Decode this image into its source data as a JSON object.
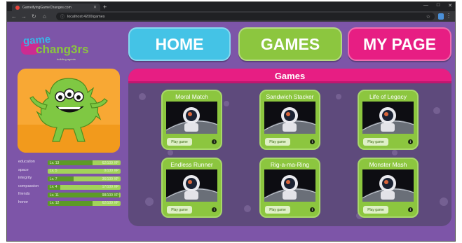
{
  "browser": {
    "tab_title": "GameifyingGameChanges.com",
    "url": "localhost:4200/games",
    "new_tab_label": "+",
    "window_controls": [
      "—",
      "□",
      "✕"
    ]
  },
  "nav": {
    "home_label": "HOME",
    "games_label": "GAMES",
    "mypage_label": "MY PAGE"
  },
  "logo": {
    "line1": "game",
    "line2": "chang3rs",
    "subtitle": "building agents"
  },
  "stats": [
    {
      "name": "education",
      "level": "Lv. 13",
      "xp": "62/100 XP",
      "progress": 0.62
    },
    {
      "name": "space",
      "level": "Lv. 5",
      "xp": "0/100 XP",
      "progress": 0.0
    },
    {
      "name": "integrity",
      "level": "Lv. 7",
      "xp": "36/100 XP",
      "progress": 0.36
    },
    {
      "name": "compassion",
      "level": "Lv. 4",
      "xp": "17/100 XP",
      "progress": 0.17
    },
    {
      "name": "friends",
      "level": "Lv. 11",
      "xp": "98/100 XP",
      "progress": 0.98
    },
    {
      "name": "honor",
      "level": "Lv. 12",
      "xp": "62/100 XP",
      "progress": 0.62
    }
  ],
  "games_panel": {
    "title": "Games",
    "cards": [
      {
        "title": "Moral Match",
        "play_label": "Play game"
      },
      {
        "title": "Sandwich Stacker",
        "play_label": "Play game"
      },
      {
        "title": "Life of Legacy",
        "play_label": "Play game"
      },
      {
        "title": "Endless Runner",
        "play_label": "Play game"
      },
      {
        "title": "Rig-a-ma-Ring",
        "play_label": "Play game"
      },
      {
        "title": "Monster Mash",
        "play_label": "Play game"
      }
    ]
  },
  "colors": {
    "background": "#7d55a8",
    "home": "#44c3e6",
    "games": "#8cc63f",
    "mypage": "#e71e83",
    "avatar_bg": "#f8a834",
    "monster": "#7fc843"
  }
}
